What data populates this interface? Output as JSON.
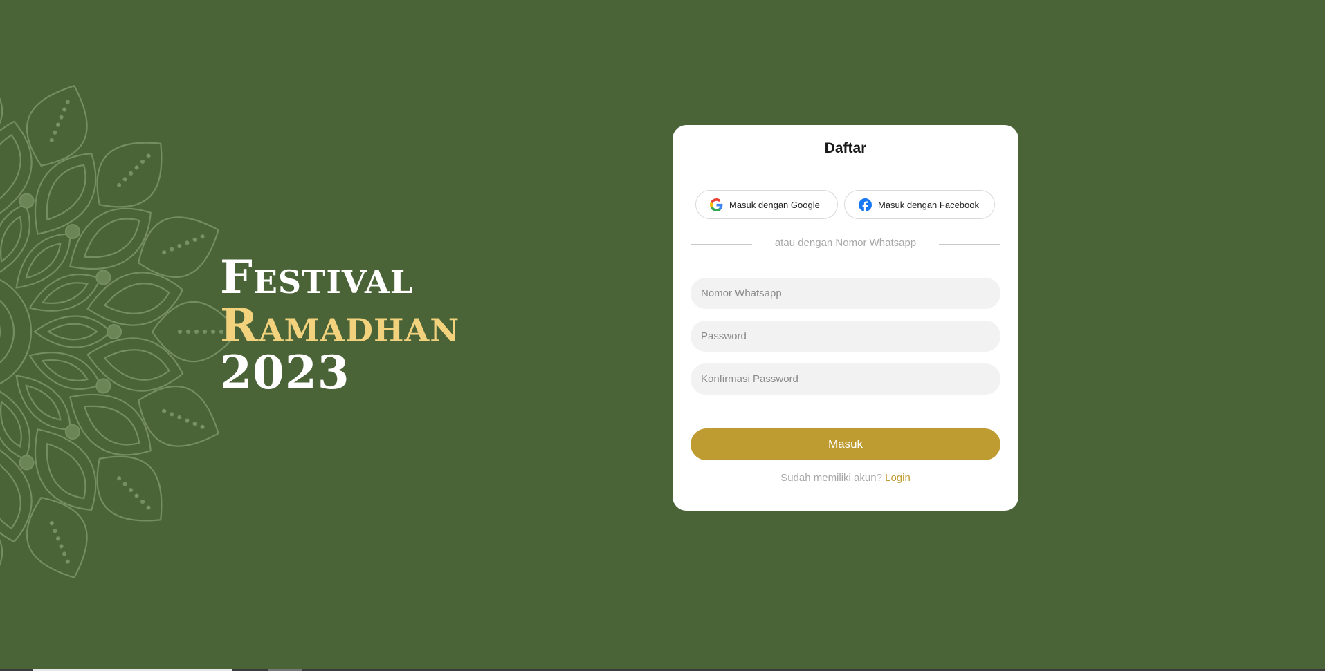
{
  "hero": {
    "line1": "Festival",
    "line2": "Ramadhan",
    "line3": "2023"
  },
  "colors": {
    "background": "#4b6437",
    "accent": "#bf9c32",
    "hero_highlight": "#f3d27e",
    "card": "#ffffff",
    "field": "#f2f2f2"
  },
  "form": {
    "title": "Daftar",
    "google_label": "Masuk dengan Google",
    "facebook_label": "Masuk dengan Facebook",
    "google_icon": "google-icon",
    "facebook_icon": "facebook-icon",
    "divider_text": "atau dengan Nomor Whatsapp",
    "phone_placeholder": "Nomor Whatsapp",
    "password_placeholder": "Password",
    "confirm_placeholder": "Konfirmasi Password",
    "submit_label": "Masuk",
    "footer_text": "Sudah memiliki akun?",
    "footer_link": "Login"
  }
}
